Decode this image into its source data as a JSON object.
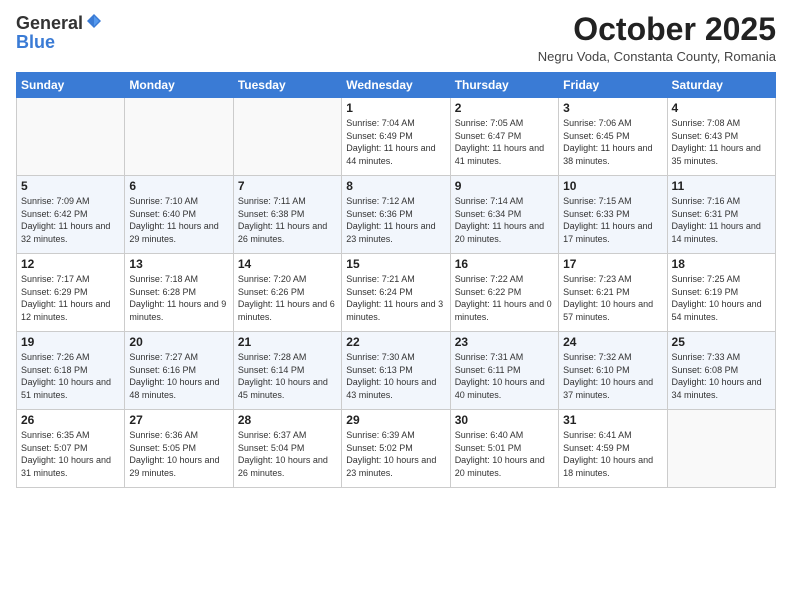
{
  "header": {
    "logo_general": "General",
    "logo_blue": "Blue",
    "month_title": "October 2025",
    "location": "Negru Voda, Constanta County, Romania"
  },
  "days_of_week": [
    "Sunday",
    "Monday",
    "Tuesday",
    "Wednesday",
    "Thursday",
    "Friday",
    "Saturday"
  ],
  "weeks": [
    [
      {
        "day": "",
        "info": ""
      },
      {
        "day": "",
        "info": ""
      },
      {
        "day": "",
        "info": ""
      },
      {
        "day": "1",
        "info": "Sunrise: 7:04 AM\nSunset: 6:49 PM\nDaylight: 11 hours and 44 minutes."
      },
      {
        "day": "2",
        "info": "Sunrise: 7:05 AM\nSunset: 6:47 PM\nDaylight: 11 hours and 41 minutes."
      },
      {
        "day": "3",
        "info": "Sunrise: 7:06 AM\nSunset: 6:45 PM\nDaylight: 11 hours and 38 minutes."
      },
      {
        "day": "4",
        "info": "Sunrise: 7:08 AM\nSunset: 6:43 PM\nDaylight: 11 hours and 35 minutes."
      }
    ],
    [
      {
        "day": "5",
        "info": "Sunrise: 7:09 AM\nSunset: 6:42 PM\nDaylight: 11 hours and 32 minutes."
      },
      {
        "day": "6",
        "info": "Sunrise: 7:10 AM\nSunset: 6:40 PM\nDaylight: 11 hours and 29 minutes."
      },
      {
        "day": "7",
        "info": "Sunrise: 7:11 AM\nSunset: 6:38 PM\nDaylight: 11 hours and 26 minutes."
      },
      {
        "day": "8",
        "info": "Sunrise: 7:12 AM\nSunset: 6:36 PM\nDaylight: 11 hours and 23 minutes."
      },
      {
        "day": "9",
        "info": "Sunrise: 7:14 AM\nSunset: 6:34 PM\nDaylight: 11 hours and 20 minutes."
      },
      {
        "day": "10",
        "info": "Sunrise: 7:15 AM\nSunset: 6:33 PM\nDaylight: 11 hours and 17 minutes."
      },
      {
        "day": "11",
        "info": "Sunrise: 7:16 AM\nSunset: 6:31 PM\nDaylight: 11 hours and 14 minutes."
      }
    ],
    [
      {
        "day": "12",
        "info": "Sunrise: 7:17 AM\nSunset: 6:29 PM\nDaylight: 11 hours and 12 minutes."
      },
      {
        "day": "13",
        "info": "Sunrise: 7:18 AM\nSunset: 6:28 PM\nDaylight: 11 hours and 9 minutes."
      },
      {
        "day": "14",
        "info": "Sunrise: 7:20 AM\nSunset: 6:26 PM\nDaylight: 11 hours and 6 minutes."
      },
      {
        "day": "15",
        "info": "Sunrise: 7:21 AM\nSunset: 6:24 PM\nDaylight: 11 hours and 3 minutes."
      },
      {
        "day": "16",
        "info": "Sunrise: 7:22 AM\nSunset: 6:22 PM\nDaylight: 11 hours and 0 minutes."
      },
      {
        "day": "17",
        "info": "Sunrise: 7:23 AM\nSunset: 6:21 PM\nDaylight: 10 hours and 57 minutes."
      },
      {
        "day": "18",
        "info": "Sunrise: 7:25 AM\nSunset: 6:19 PM\nDaylight: 10 hours and 54 minutes."
      }
    ],
    [
      {
        "day": "19",
        "info": "Sunrise: 7:26 AM\nSunset: 6:18 PM\nDaylight: 10 hours and 51 minutes."
      },
      {
        "day": "20",
        "info": "Sunrise: 7:27 AM\nSunset: 6:16 PM\nDaylight: 10 hours and 48 minutes."
      },
      {
        "day": "21",
        "info": "Sunrise: 7:28 AM\nSunset: 6:14 PM\nDaylight: 10 hours and 45 minutes."
      },
      {
        "day": "22",
        "info": "Sunrise: 7:30 AM\nSunset: 6:13 PM\nDaylight: 10 hours and 43 minutes."
      },
      {
        "day": "23",
        "info": "Sunrise: 7:31 AM\nSunset: 6:11 PM\nDaylight: 10 hours and 40 minutes."
      },
      {
        "day": "24",
        "info": "Sunrise: 7:32 AM\nSunset: 6:10 PM\nDaylight: 10 hours and 37 minutes."
      },
      {
        "day": "25",
        "info": "Sunrise: 7:33 AM\nSunset: 6:08 PM\nDaylight: 10 hours and 34 minutes."
      }
    ],
    [
      {
        "day": "26",
        "info": "Sunrise: 6:35 AM\nSunset: 5:07 PM\nDaylight: 10 hours and 31 minutes."
      },
      {
        "day": "27",
        "info": "Sunrise: 6:36 AM\nSunset: 5:05 PM\nDaylight: 10 hours and 29 minutes."
      },
      {
        "day": "28",
        "info": "Sunrise: 6:37 AM\nSunset: 5:04 PM\nDaylight: 10 hours and 26 minutes."
      },
      {
        "day": "29",
        "info": "Sunrise: 6:39 AM\nSunset: 5:02 PM\nDaylight: 10 hours and 23 minutes."
      },
      {
        "day": "30",
        "info": "Sunrise: 6:40 AM\nSunset: 5:01 PM\nDaylight: 10 hours and 20 minutes."
      },
      {
        "day": "31",
        "info": "Sunrise: 6:41 AM\nSunset: 4:59 PM\nDaylight: 10 hours and 18 minutes."
      },
      {
        "day": "",
        "info": ""
      }
    ]
  ]
}
